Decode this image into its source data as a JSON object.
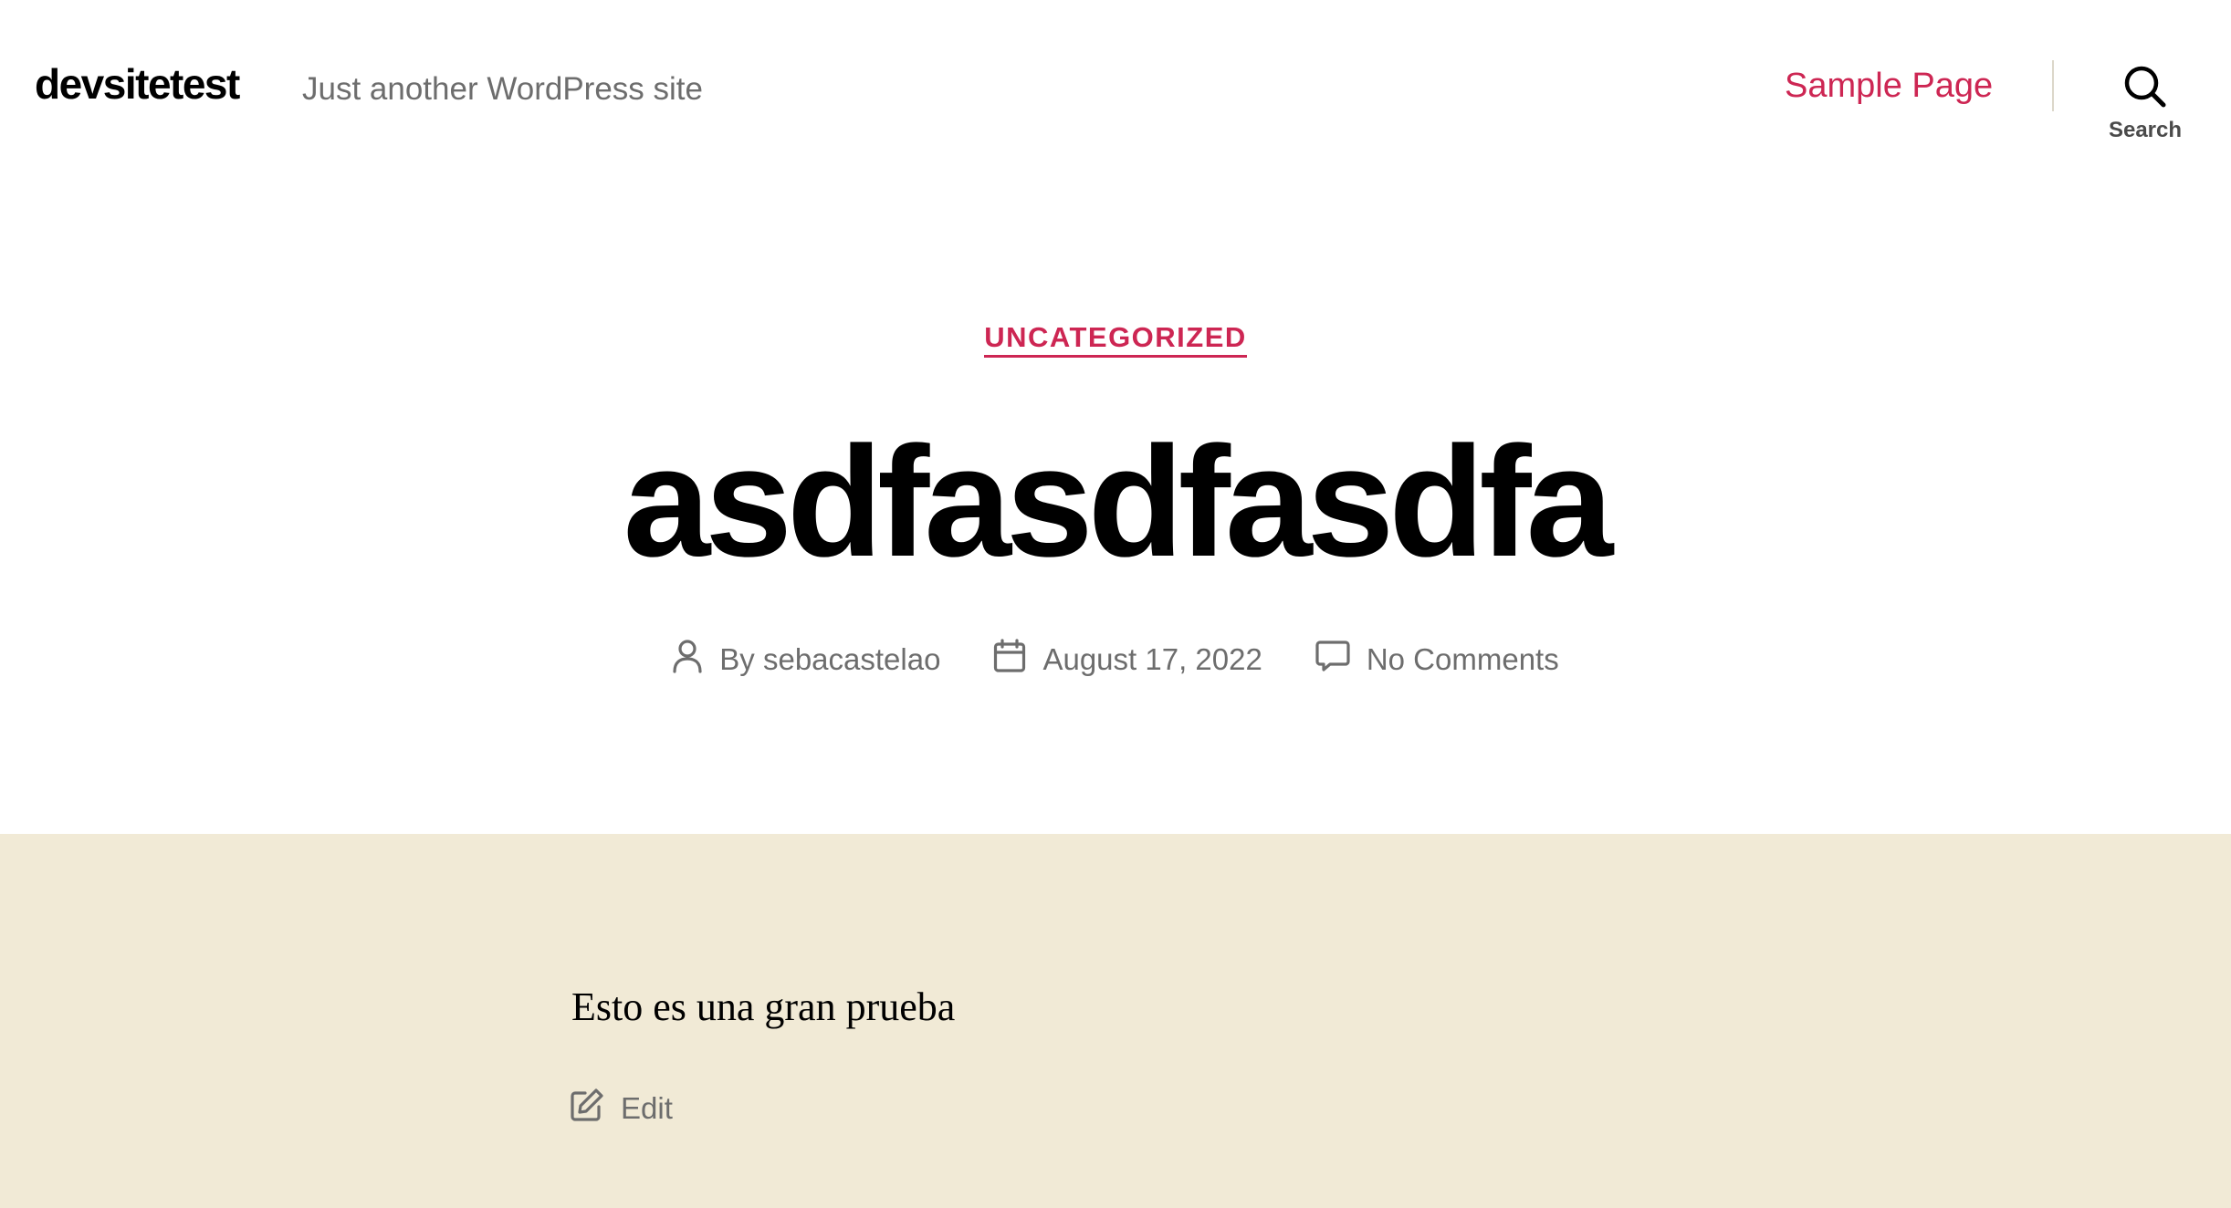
{
  "header": {
    "site_title": "devsitetest",
    "site_description": "Just another WordPress site",
    "nav": [
      {
        "label": "Sample Page"
      }
    ],
    "search_label": "Search"
  },
  "post": {
    "category": "UNCATEGORIZED",
    "title": "asdfasdfasdfa",
    "meta": {
      "author_prefix": "By",
      "author": "sebacastelao",
      "date": "August 17, 2022",
      "comments": "No Comments"
    },
    "content": "Esto es una gran prueba",
    "edit_label": "Edit"
  },
  "colors": {
    "accent": "#cd2653",
    "content_background": "#f1ead6",
    "meta_text": "#6d6d6d"
  },
  "icons": {
    "search": "search-icon",
    "author": "user-icon",
    "date": "calendar-icon",
    "comments": "comment-icon",
    "edit": "edit-icon"
  }
}
